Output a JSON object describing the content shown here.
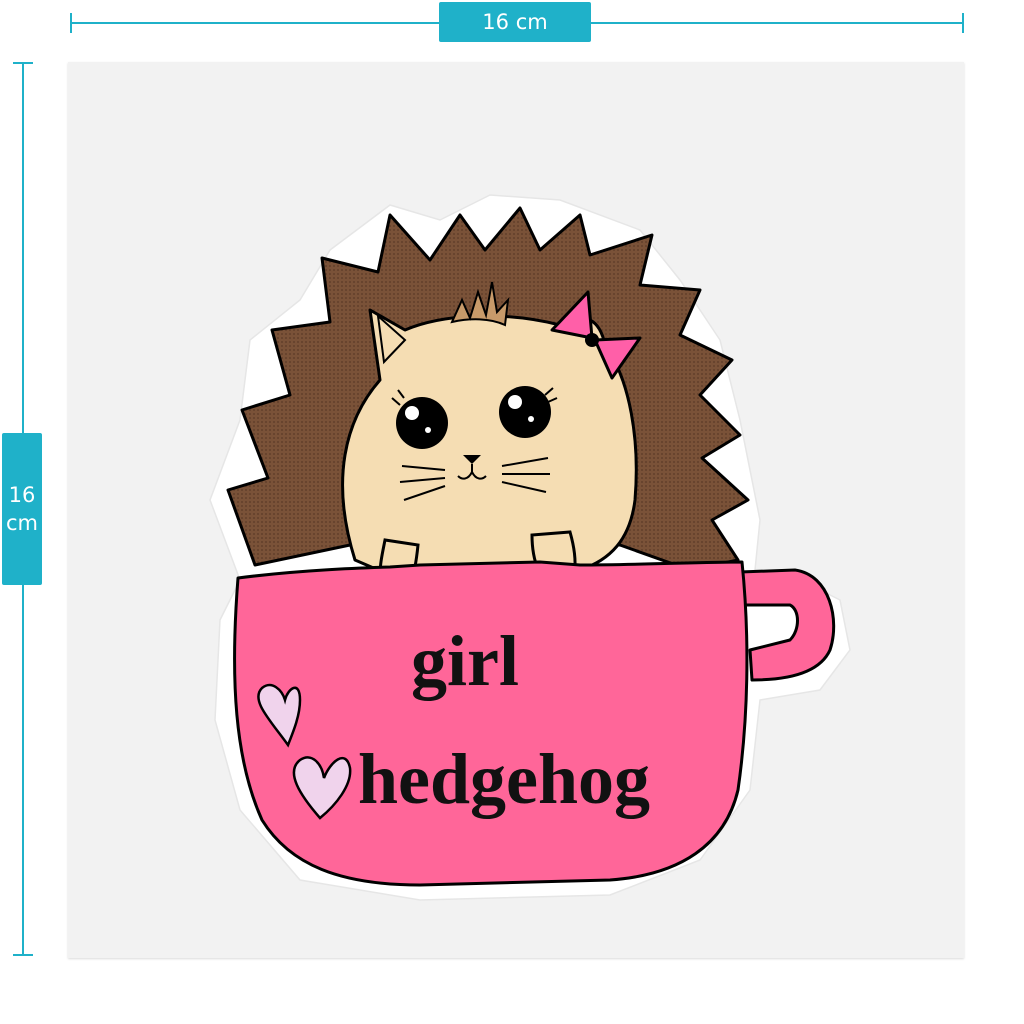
{
  "dimensions": {
    "width_label": "16 cm",
    "height_value": "16",
    "height_unit": "cm"
  },
  "sticker": {
    "line1": "girl",
    "line2": "hedgehog"
  },
  "colors": {
    "accent": "#1fb1c9",
    "cup": "#ff6699",
    "spines": "#7a5238",
    "face": "#f5ddb3",
    "heart": "#f0d3ec",
    "bow": "#ff5fa8"
  }
}
